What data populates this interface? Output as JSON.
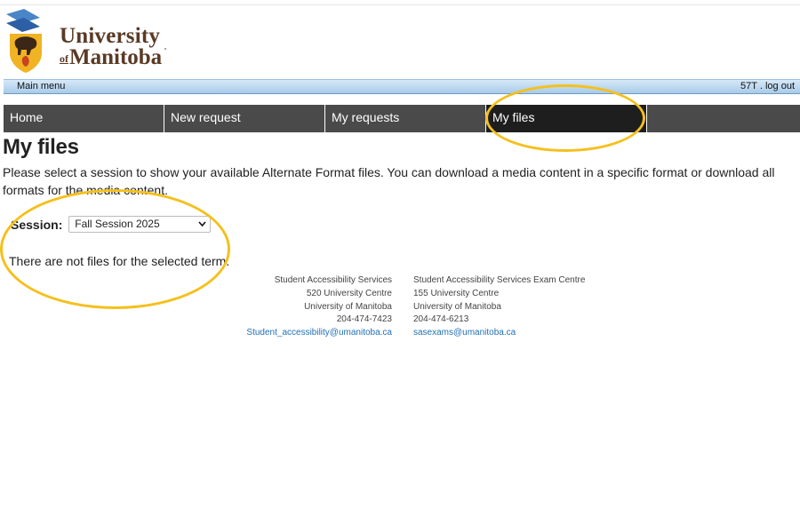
{
  "logo": {
    "line1": "University",
    "of": "of",
    "line2": "Manitoba"
  },
  "menubar": {
    "main_menu": "Main menu",
    "user": "57T",
    "separator": ".",
    "logout": "log out"
  },
  "nav": {
    "tabs": [
      {
        "label": "Home"
      },
      {
        "label": "New request"
      },
      {
        "label": "My requests"
      },
      {
        "label": "My files",
        "active": true
      }
    ]
  },
  "page": {
    "title": "My files",
    "intro": "Please select a session to show your available Alternate Format files. You can download a media content in a specific format or download all formats for the media content."
  },
  "session": {
    "label": "Session:",
    "selected": "Fall Session 2025",
    "icon": "chevron-down-icon"
  },
  "message": "There are not files for the selected term.",
  "contacts": [
    {
      "name": "Student Accessibility Services",
      "address": "520 University Centre",
      "org": "University of Manitoba",
      "phone": "204-474-7423",
      "email": "Student_accessibility@umanitoba.ca"
    },
    {
      "name": "Student Accessibility Services Exam Centre",
      "address": "155 University Centre",
      "org": "University of Manitoba",
      "phone": "204-474-6213",
      "email": "sasexams@umanitoba.ca"
    }
  ],
  "colors": {
    "highlight": "#f5c01d",
    "nav_bg": "#4a4a4a",
    "nav_active": "#1e1e1e",
    "link": "#1f6fb5",
    "brand_brown": "#5a3a26"
  }
}
